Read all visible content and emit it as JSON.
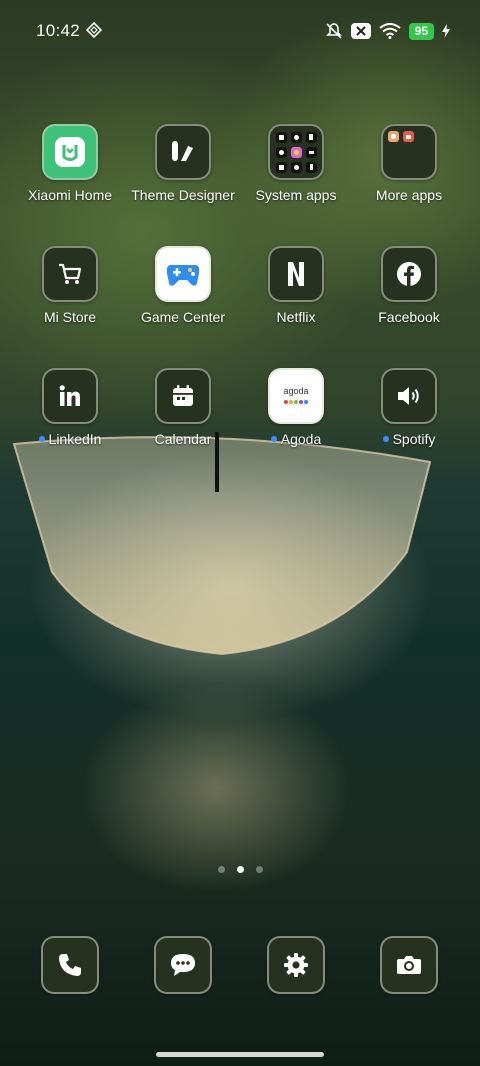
{
  "status_bar": {
    "time": "10:42",
    "battery": "95",
    "icons": [
      "vpn-diamond-icon",
      "mute-icon",
      "x-badge-icon",
      "wifi-icon",
      "charging-bolt-icon"
    ]
  },
  "home": {
    "rows": [
      [
        {
          "label": "Xiaomi Home",
          "icon": "xiaomi-home-icon",
          "dot": false
        },
        {
          "label": "Theme Designer",
          "icon": "theme-designer-icon",
          "dot": false
        },
        {
          "label": "System apps",
          "icon": "folder-icon",
          "dot": false
        },
        {
          "label": "More apps",
          "icon": "folder-icon",
          "dot": false
        }
      ],
      [
        {
          "label": "Mi Store",
          "icon": "cart-icon",
          "dot": false
        },
        {
          "label": "Game Center",
          "icon": "gamepad-icon",
          "dot": false
        },
        {
          "label": "Netflix",
          "icon": "netflix-icon",
          "dot": false
        },
        {
          "label": "Facebook",
          "icon": "facebook-icon",
          "dot": false
        }
      ],
      [
        {
          "label": "LinkedIn",
          "icon": "linkedin-icon",
          "dot": true
        },
        {
          "label": "Calendar",
          "icon": "calendar-icon",
          "dot": false
        },
        {
          "label": "Agoda",
          "icon": "agoda-icon",
          "dot": true,
          "logo_text": "agoda"
        },
        {
          "label": "Spotify",
          "icon": "speaker-icon",
          "dot": true
        }
      ]
    ]
  },
  "page_indicator": {
    "count": 3,
    "active": 1
  },
  "dock": [
    {
      "icon": "phone-icon"
    },
    {
      "icon": "messages-icon"
    },
    {
      "icon": "settings-gear-icon"
    },
    {
      "icon": "camera-icon"
    }
  ],
  "colors": {
    "icon_bg": "#26311f",
    "notification_dot": "#3a8dff",
    "battery": "#34c74a"
  }
}
